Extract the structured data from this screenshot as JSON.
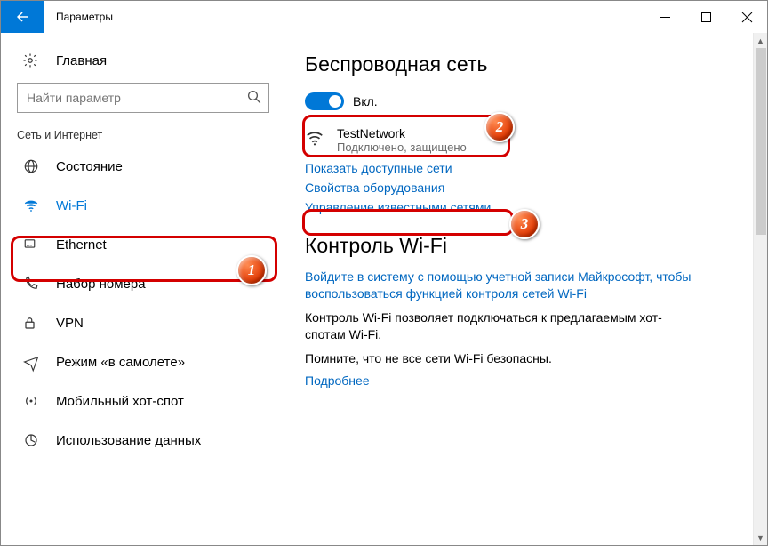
{
  "window": {
    "title": "Параметры"
  },
  "sidebar": {
    "home": "Главная",
    "search_placeholder": "Найти параметр",
    "section": "Сеть и Интернет",
    "items": [
      {
        "label": "Состояние"
      },
      {
        "label": "Wi-Fi"
      },
      {
        "label": "Ethernet"
      },
      {
        "label": "Набор номера"
      },
      {
        "label": "VPN"
      },
      {
        "label": "Режим «в самолете»"
      },
      {
        "label": "Мобильный хот-спот"
      },
      {
        "label": "Использование данных"
      }
    ]
  },
  "main": {
    "heading1": "Беспроводная сеть",
    "toggle_label": "Вкл.",
    "network": {
      "name": "TestNetwork",
      "status": "Подключено, защищено"
    },
    "link_show_networks": "Показать доступные сети",
    "link_hardware": "Свойства оборудования",
    "link_manage": "Управление известными сетями",
    "heading2": "Контроль Wi-Fi",
    "signin_link": "Войдите в систему с помощью учетной записи Майкрософт, чтобы воспользоваться функцией контроля сетей Wi-Fi",
    "body1": "Контроль Wi-Fi позволяет подключаться к предлагаемым хот-спотам Wi-Fi.",
    "body2": "Помните, что не все сети Wi-Fi безопасны.",
    "link_more": "Подробнее"
  },
  "annotations": {
    "b1": "1",
    "b2": "2",
    "b3": "3"
  }
}
